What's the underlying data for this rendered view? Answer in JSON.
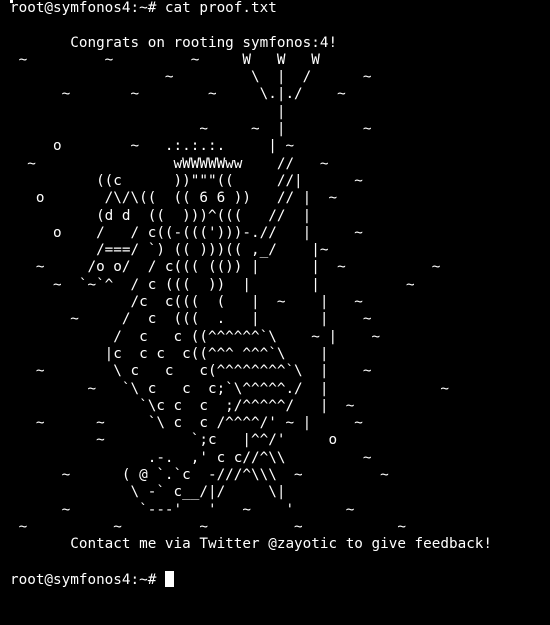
{
  "terminal": {
    "lines": [
      "root@symfonos4:~# cat proof.txt",
      "",
      "       Congrats on rooting symfonos:4!",
      " ~         ~         ~     W   W   W",
      "                  ~         \\  |  /      ~",
      "      ~       ~        ~     \\.|./    ~",
      "                               |",
      "                      ~     ~  |         ~",
      "     o        ~   .:.:.:.     | ~",
      "  ~                wWWWWWww    //   ~",
      "          ((c      ))\"\"\"((     //|      ~",
      "   o       /\\/\\((  (( 6 6 ))   // |  ~",
      "          (d d  ((  )))^(((   //  |",
      "     o    /   / c((-(((')))-.//   |     ~",
      "          /===/ `) (( )))(( ,_/    |~",
      "   ~     /o o/  / c((( (()) |      |  ~          ~",
      "     ~  `~`^  / c (((  ))  |       |          ~",
      "              /c  c(((  (   |  ~    |   ~",
      "       ~     /  c  (((  .   |       |    ~",
      "            /  c   c ((^^^^^^`\\    ~ |    ~",
      "           |c  c c  c((^^^ ^^^`\\    |",
      "   ~        \\ c   c   c(^^^^^^^^`\\  |    ~",
      "         ~   `\\ c   c  c;`\\^^^^^./  |             ~",
      "               `\\c c  c  ;/^^^^^/   |  ~",
      "   ~      ~     `\\ c  c /^^^^/' ~ |     ~",
      "          ~          `;c   |^^/'     o",
      "                .-.  ,' c c//^\\\\         ~",
      "      ~      ( @ `.`c  -///^\\\\\\  ~         ~",
      "              \\ -` c__/|/     \\|",
      "      ~        `---'   '   ~    '      ~",
      " ~          ~         ~          ~           ~",
      "       Contact me via Twitter @zayotic to give feedback!",
      "",
      "root@symfonos4:~# "
    ]
  }
}
